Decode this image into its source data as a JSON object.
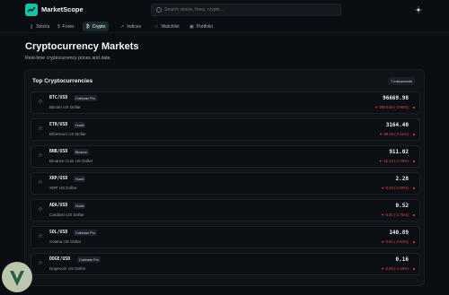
{
  "app": {
    "brand": "MarketScope"
  },
  "search": {
    "placeholder": "Search stocks, forex, crypto..."
  },
  "nav": {
    "tabs": [
      {
        "label": "Stocks",
        "icon": "bar-chart-icon",
        "glyph": "❙"
      },
      {
        "label": "Forex",
        "icon": "dollar-icon",
        "glyph": "$"
      },
      {
        "label": "Crypto",
        "icon": "bitcoin-icon",
        "glyph": "₿",
        "active": true
      },
      {
        "label": "Indices",
        "icon": "trend-icon",
        "glyph": "↗"
      },
      {
        "label": "Watchlist",
        "icon": "star-icon",
        "glyph": "☆"
      },
      {
        "label": "Portfolio",
        "icon": "briefcase-icon",
        "glyph": "▣"
      }
    ]
  },
  "page": {
    "title": "Cryptocurrency Markets",
    "subtitle": "Real-time cryptocurrency prices and data"
  },
  "card": {
    "title": "Top Cryptocurrencies",
    "count_label": "7 instruments",
    "rows": [
      {
        "symbol": "BTC/USD",
        "exchange": "Coinbase Pro",
        "name": "Bitcoin US Dollar",
        "price": "96669.98",
        "change": "▾ -2844.55 (-2.96%)"
      },
      {
        "symbol": "ETH/USD",
        "exchange": "Huobi",
        "name": "Ethereum US Dollar",
        "price": "3164.40",
        "change": "▾ -69.26 (-2.11%)"
      },
      {
        "symbol": "BNB/USD",
        "exchange": "Binance",
        "name": "Binance Coin US Dollar",
        "price": "911.02",
        "change": "▾ -16.23 (-1.76%)"
      },
      {
        "symbol": "XRP/USD",
        "exchange": "Huobi",
        "name": "XRP US Dollar",
        "price": "2.28",
        "change": "▾ -0.03 (-1.59%)"
      },
      {
        "symbol": "ADA/USD",
        "exchange": "Huobi",
        "name": "Cardano US Dollar",
        "price": "0.52",
        "change": "▾ -0.01 (-2.75%)"
      },
      {
        "symbol": "SOL/USD",
        "exchange": "Coinbase Pro",
        "name": "Solana US Dollar",
        "price": "140.89",
        "change": "▾ -3.81 (-2.63%)"
      },
      {
        "symbol": "DOGE/USD",
        "exchange": "Coinbase Pro",
        "name": "Dogecoin US Dollar",
        "price": "0.16",
        "change": "▾ -0.00 (-1.16%)"
      }
    ]
  },
  "colors": {
    "accent": "#17c3a6",
    "negative": "#e24b4b",
    "background": "#0a0d12",
    "card": "#0f1318"
  }
}
